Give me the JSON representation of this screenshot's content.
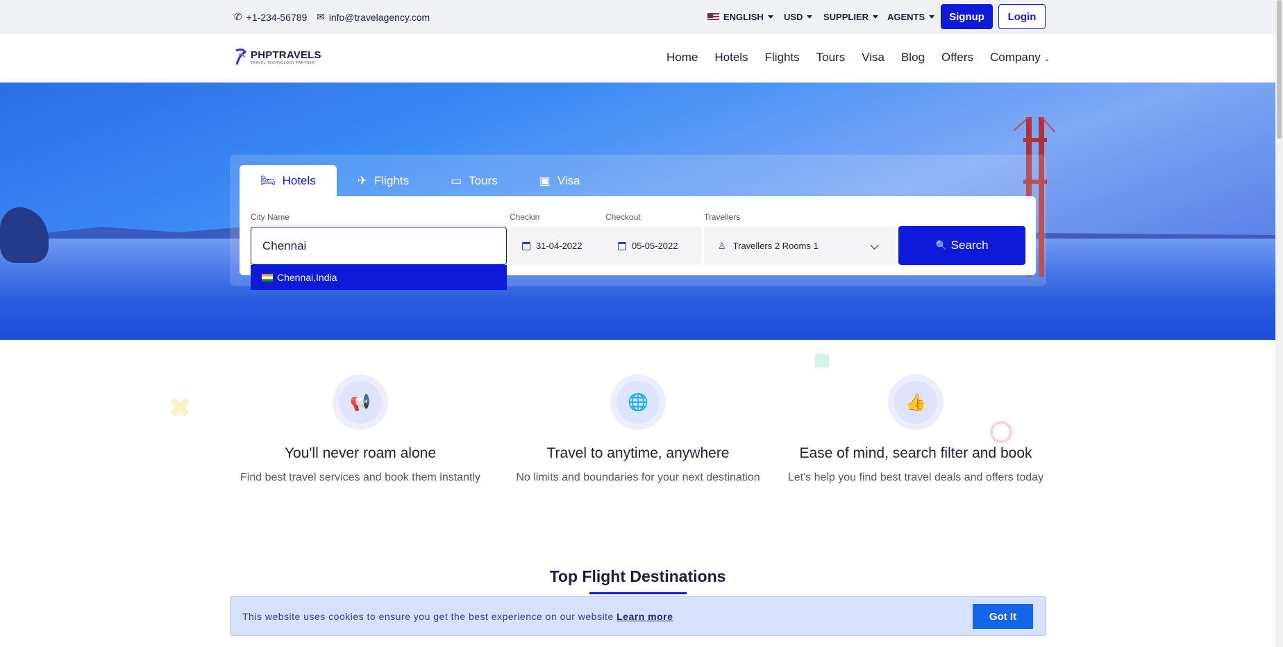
{
  "topbar": {
    "phone": "+1-234-56789",
    "email": "info@travelagency.com",
    "language": "ENGLISH",
    "currency": "USD",
    "supplier": "SUPPLIER",
    "agents": "AGENTS",
    "signup": "Signup",
    "login": "Login"
  },
  "navbar": {
    "logo_text": "PHPTRAVELS",
    "logo_sub": "TRAVEL TECHNOLOGY PARTNER",
    "links": [
      "Home",
      "Hotels",
      "Flights",
      "Tours",
      "Visa",
      "Blog",
      "Offers",
      "Company"
    ]
  },
  "search": {
    "tabs": [
      "Hotels",
      "Flights",
      "Tours",
      "Visa"
    ],
    "active_tab": "Hotels",
    "city_label": "City Name",
    "city_value": "Chennai",
    "checkin_label": "Checkin",
    "checkin_value": "31-04-2022",
    "checkout_label": "Checkout",
    "checkout_value": "05-05-2022",
    "travellers_label": "Travellers",
    "travellers_value": "Travellers 2 Rooms 1",
    "search_button": "Search",
    "suggestion": "Chennai,India"
  },
  "features": [
    {
      "icon": "megaphone-icon",
      "title": "You'll never roam alone",
      "text": "Find best travel services and book them instantly"
    },
    {
      "icon": "globe-icon",
      "title": "Travel to anytime, anywhere",
      "text": "No limits and boundaries for your next destination"
    },
    {
      "icon": "thumbs-up-icon",
      "title": "Ease of mind, search filter and book",
      "text": "Let's help you find best travel deals and offers today"
    }
  ],
  "section_title": "Top Flight Destinations",
  "cookie": {
    "message": "This website uses cookies to ensure you get the best experience on our website",
    "learn_more": "Learn more",
    "button": "Got It"
  },
  "colors": {
    "accent": "#0d1ad9",
    "cookie_bg": "#d6e2fc",
    "cookie_button": "#1565e8"
  }
}
